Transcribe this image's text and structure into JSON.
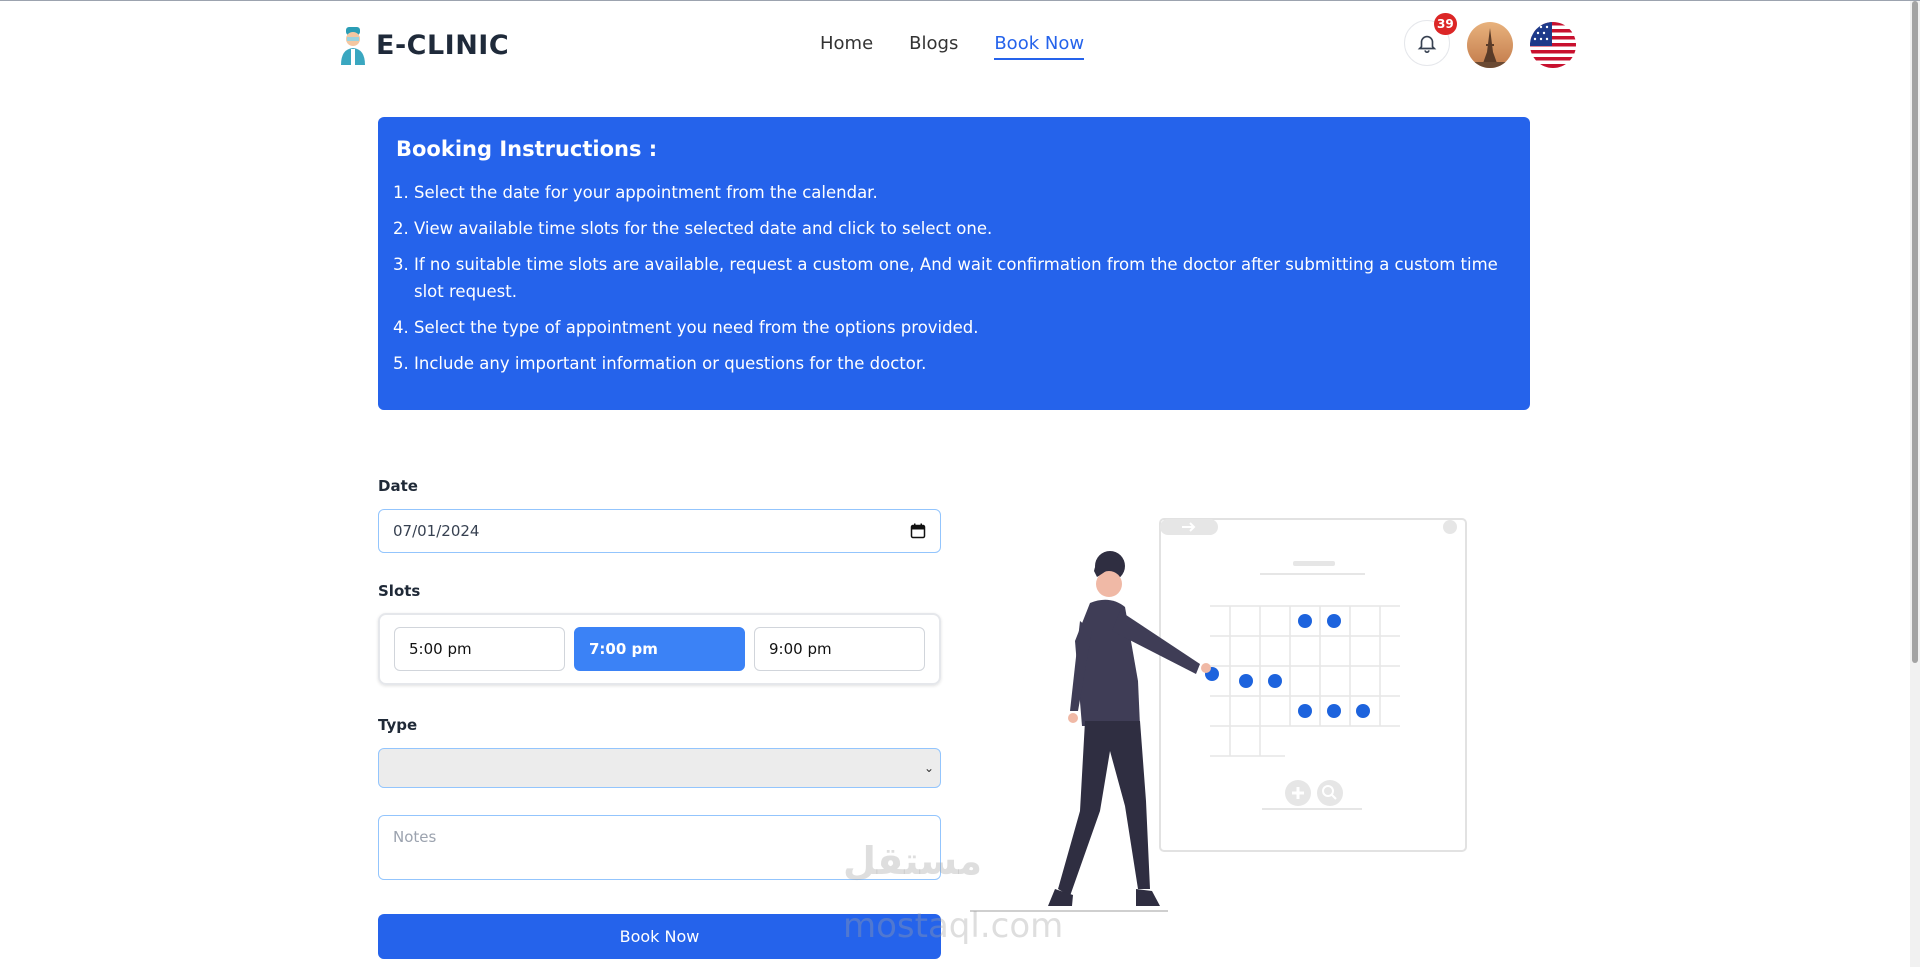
{
  "header": {
    "brand": "E-CLINIC",
    "nav": [
      {
        "label": "Home"
      },
      {
        "label": "Blogs"
      },
      {
        "label": "Book Now",
        "active": true
      }
    ],
    "notification_count": "39"
  },
  "instructions": {
    "title": "Booking Instructions :",
    "items": [
      "Select the date for your appointment from the calendar.",
      "View available time slots for the selected date and click to select one.",
      "If no suitable time slots are available, request a custom one, And wait confirmation from the doctor after submitting a custom time slot request.",
      "Select the type of appointment you need from the options provided.",
      "Include any important information or questions for the doctor."
    ]
  },
  "form": {
    "date_label": "Date",
    "date_value": "07/01/2024",
    "slots_label": "Slots",
    "slots": [
      "5:00 pm",
      "7:00 pm",
      "9:00 pm"
    ],
    "selected_slot": "7:00 pm",
    "type_label": "Type",
    "type_value": "",
    "notes_placeholder": "Notes",
    "submit_label": "Book Now"
  },
  "watermark": {
    "arabic": "مستقل",
    "latin": "mostaql.com"
  },
  "colors": {
    "primary": "#2563eb",
    "slot_selected": "#3b82f6",
    "badge": "#dc2626"
  }
}
